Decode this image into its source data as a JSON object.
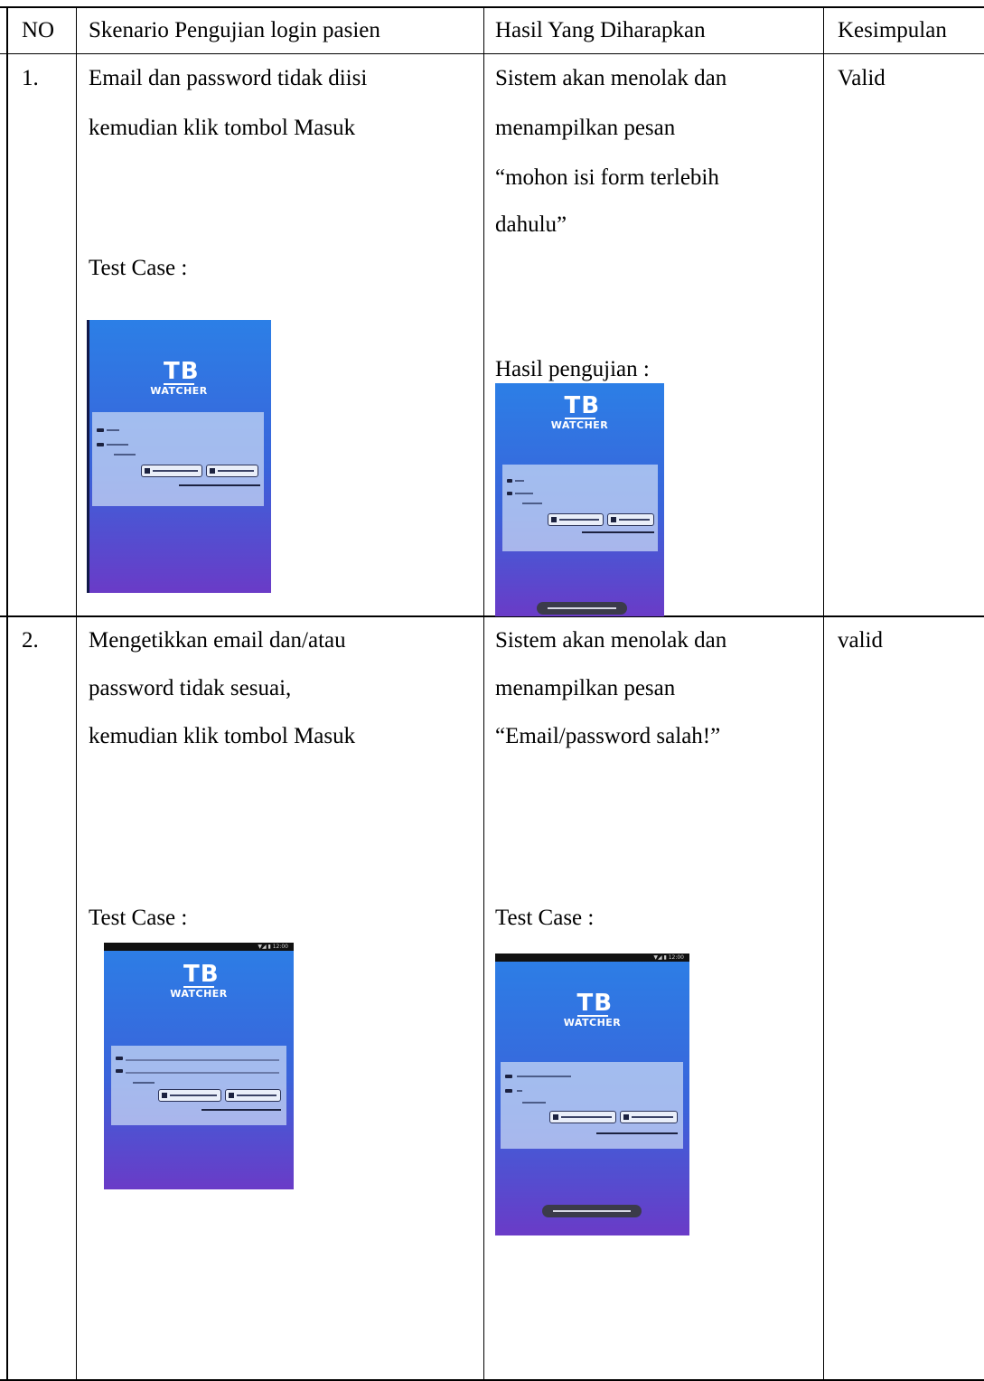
{
  "table": {
    "headers": {
      "no": "NO",
      "skenario": "Skenario Pengujian login pasien",
      "hasil": "Hasil Yang Diharapkan",
      "kesimpulan": "Kesimpulan"
    },
    "rows": [
      {
        "no": "1.",
        "skenario": [
          "Email dan password tidak diisi",
          "kemudian klik tombol Masuk"
        ],
        "skenario_caption": "Test Case :",
        "hasil": [
          "Sistem akan menolak dan",
          "menampilkan pesan",
          "“mohon isi form terlebih",
          "dahulu”"
        ],
        "hasil_caption": "Hasil pengujian :",
        "kesimpulan": "Valid"
      },
      {
        "no": "2.",
        "skenario": [
          "Mengetikkan email dan/atau",
          "password tidak sesuai,",
          "kemudian klik tombol Masuk"
        ],
        "skenario_caption": "Test Case :",
        "hasil": [
          "Sistem akan menolak dan",
          "menampilkan pesan",
          "“Email/password salah!”"
        ],
        "hasil_caption": "Test Case :",
        "kesimpulan": "valid"
      }
    ]
  },
  "screenshots": {
    "logo_top": "TB",
    "logo_bottom": "WATCHER"
  }
}
